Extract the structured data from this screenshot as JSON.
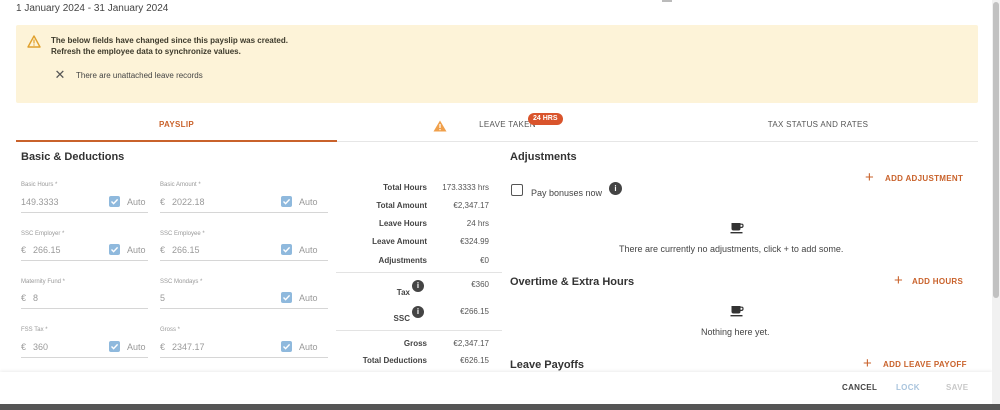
{
  "period": "1 January 2024 - 31 January 2024",
  "alert": {
    "line1": "The below fields have changed since this payslip was created.",
    "line2": "Refresh the employee data to synchronize values.",
    "item": "There are unattached leave records",
    "icon": "warning-icon",
    "color": "#fdf3d8"
  },
  "tabs": {
    "payslip": "PAYSLIP",
    "leave_taken": "LEAVE TAKEN",
    "leave_badge": "24 HRS",
    "tax_status": "TAX STATUS AND RATES",
    "active_color": "#c9622b"
  },
  "basic": {
    "title": "Basic & Deductions",
    "fields": {
      "basic_hours": {
        "label": "Basic Hours *",
        "value": "149.3333",
        "auto": "Auto"
      },
      "basic_amount": {
        "label": "Basic Amount *",
        "prefix": "€",
        "value": "2022.18",
        "auto": "Auto"
      },
      "ssc_employer": {
        "label": "SSC Employer *",
        "prefix": "€",
        "value": "266.15",
        "auto": "Auto"
      },
      "ssc_employee": {
        "label": "SSC Employee *",
        "prefix": "€",
        "value": "266.15",
        "auto": "Auto"
      },
      "maternity_fund": {
        "label": "Maternity Fund *",
        "prefix": "€",
        "value": "8",
        "auto": "Auto"
      },
      "ssc_mondays": {
        "label": "SSC Mondays *",
        "value": "5",
        "auto": "Auto"
      },
      "fss_tax": {
        "label": "FSS Tax *",
        "prefix": "€",
        "value": "360",
        "auto": "Auto"
      },
      "gross": {
        "label": "Gross *",
        "prefix": "€",
        "value": "2347.17",
        "auto": "Auto"
      }
    }
  },
  "summary": {
    "total_hours": {
      "label": "Total Hours",
      "value": "173.3333 hrs"
    },
    "total_amount": {
      "label": "Total Amount",
      "value": "€2,347.17"
    },
    "leave_hours": {
      "label": "Leave Hours",
      "value": "24 hrs"
    },
    "leave_amount": {
      "label": "Leave Amount",
      "value": "€324.99"
    },
    "adjustments": {
      "label": "Adjustments",
      "value": "€0"
    },
    "tax": {
      "label": "Tax",
      "value": "€360"
    },
    "ssc": {
      "label": "SSC",
      "value": "€266.15"
    },
    "gross": {
      "label": "Gross",
      "value": "€2,347.17"
    },
    "total_deductions": {
      "label": "Total Deductions",
      "value": "€626.15"
    }
  },
  "adjustments": {
    "title": "Adjustments",
    "pay_bonuses": "Pay bonuses now",
    "add_label": "ADD ADJUSTMENT",
    "empty": "There are currently no adjustments, click + to add some."
  },
  "overtime": {
    "title": "Overtime & Extra Hours",
    "add_label": "ADD HOURS",
    "empty": "Nothing here yet."
  },
  "leave_payoffs": {
    "title": "Leave Payoffs",
    "add_label": "ADD LEAVE PAYOFF"
  },
  "footer": {
    "cancel": "CANCEL",
    "lock": "LOCK",
    "save": "SAVE"
  }
}
